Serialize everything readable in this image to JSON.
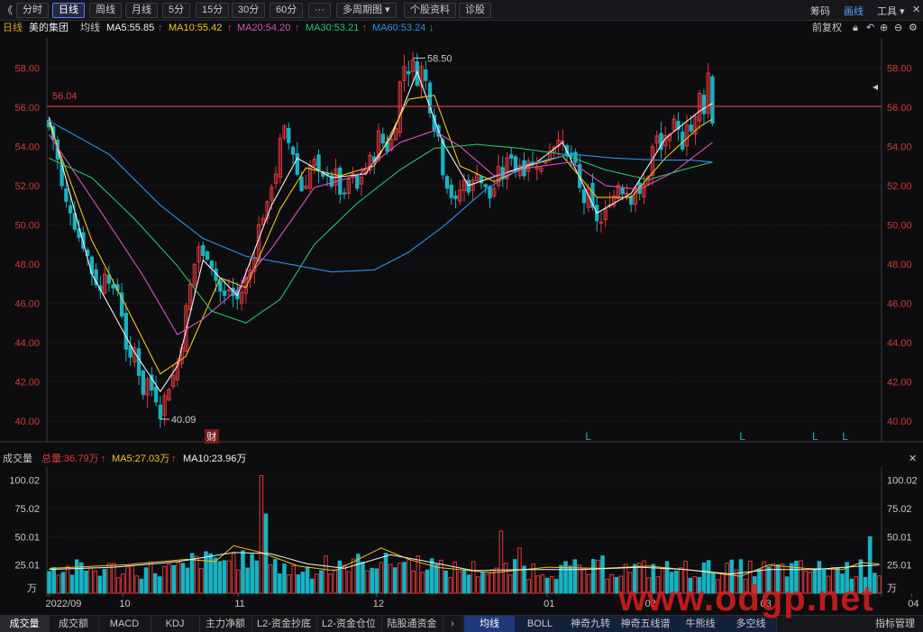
{
  "toolbar": {
    "back_glyph": "《",
    "tabs": [
      "分时",
      "日线",
      "周线",
      "月线",
      "5分",
      "15分",
      "30分",
      "60分",
      "···",
      "多周期图 ▾",
      "个股资料",
      "诊股"
    ],
    "active_tab": "日线",
    "right_items": [
      "筹码",
      "画线",
      "工具 ▾"
    ]
  },
  "info": {
    "period": "日线",
    "stock_name": "美的集团",
    "ma_label": "均线",
    "ma5": "MA5:55.85",
    "ma10": "MA10:55.42",
    "ma20": "MA20:54.20",
    "ma30": "MA30:53.21",
    "ma60": "MA60:53.24",
    "adjust": "前复权"
  },
  "colors": {
    "up": "#e0383b",
    "down": "#17b3c2",
    "ma5": "#f2f2f2",
    "ma10": "#f0c419",
    "ma20": "#e04fc2",
    "ma30": "#25c26a",
    "ma60": "#2f8ff0",
    "vol_ma5": "#f0c419",
    "vol_ma10": "#f2f2f2",
    "axis_text": "#d03a3a",
    "grid": "#252629"
  },
  "annotations": {
    "high_label": "58.50",
    "low_label": "40.09",
    "hline_label": "56.04",
    "hline_value": 56.04,
    "fin_badge": "财",
    "l_marker": "L"
  },
  "volume_info": {
    "title": "成交量",
    "total": "总量:36.79万",
    "ma5": "MA5:27.03万",
    "ma10": "MA10:23.96万",
    "unit": "万"
  },
  "bottom_tabs": [
    "成交量",
    "成交额",
    "MACD",
    "KDJ",
    "主力净额",
    "L2-资金抄底",
    "L2-资金仓位",
    "陆股通资金",
    "›",
    "均线",
    "BOLL",
    "神奇九转",
    "神奇五线谱",
    "牛熊线",
    "多空线",
    "指标管理"
  ],
  "watermark": "www.odgp.net",
  "chart_data": {
    "type": "candlestick",
    "price_axis": {
      "ylim": [
        39.4,
        59.3
      ],
      "ticks": [
        "58.00",
        "56.00",
        "54.00",
        "52.00",
        "50.00",
        "48.00",
        "46.00",
        "44.00",
        "42.00",
        "40.00"
      ]
    },
    "volume_axis": {
      "ylim": [
        0,
        110
      ],
      "ticks": [
        "100.02",
        "75.02",
        "50.01",
        "25.01"
      ],
      "unit": "万"
    },
    "x_labels": [
      "2022/09",
      "10",
      "11",
      "12",
      "01",
      "02",
      "03",
      "04"
    ],
    "x_label_bars": [
      0,
      16,
      41,
      71,
      108,
      130,
      155,
      187
    ],
    "l_marker_bars": [
      126,
      162,
      179,
      186
    ],
    "fin_badge_bar": 38,
    "close_path": [
      [
        0,
        55.0
      ],
      [
        1,
        54.4
      ],
      [
        2,
        53.3
      ],
      [
        3,
        51.9
      ],
      [
        4,
        51.1
      ],
      [
        5,
        50.8
      ],
      [
        6,
        50.0
      ],
      [
        7,
        49.4
      ],
      [
        8,
        49.0
      ],
      [
        9,
        48.4
      ],
      [
        10,
        47.6
      ],
      [
        11,
        47.1
      ],
      [
        12,
        46.6
      ],
      [
        13,
        47.7
      ],
      [
        14,
        47.3
      ],
      [
        15,
        46.5
      ],
      [
        16,
        46.7
      ],
      [
        17,
        45.5
      ],
      [
        18,
        43.8
      ],
      [
        19,
        43.0
      ],
      [
        20,
        43.7
      ],
      [
        21,
        42.5
      ],
      [
        22,
        41.5
      ],
      [
        23,
        42.1
      ],
      [
        24,
        41.6
      ],
      [
        25,
        41.2
      ],
      [
        26,
        40.4
      ],
      [
        27,
        41.2
      ],
      [
        28,
        41.8
      ],
      [
        29,
        42.3
      ],
      [
        30,
        43.0
      ],
      [
        31,
        44.0
      ],
      [
        32,
        45.7
      ],
      [
        33,
        46.9
      ],
      [
        34,
        48.0
      ],
      [
        35,
        48.9
      ],
      [
        36,
        48.3
      ],
      [
        37,
        48.5
      ],
      [
        38,
        48.0
      ],
      [
        39,
        47.2
      ],
      [
        40,
        46.6
      ],
      [
        41,
        46.3
      ],
      [
        42,
        46.7
      ],
      [
        43,
        46.4
      ],
      [
        44,
        46.2
      ],
      [
        45,
        46.6
      ],
      [
        46,
        47.2
      ],
      [
        47,
        47.7
      ],
      [
        48,
        48.6
      ],
      [
        49,
        49.9
      ],
      [
        50,
        50.5
      ],
      [
        51,
        50.9
      ],
      [
        52,
        52.1
      ],
      [
        53,
        52.7
      ],
      [
        54,
        54.2
      ],
      [
        55,
        54.8
      ],
      [
        56,
        54.2
      ],
      [
        57,
        53.7
      ],
      [
        58,
        52.6
      ],
      [
        59,
        51.8
      ],
      [
        60,
        52.2
      ],
      [
        61,
        53.0
      ],
      [
        62,
        53.2
      ],
      [
        63,
        52.5
      ],
      [
        64,
        52.3
      ],
      [
        65,
        52.8
      ],
      [
        66,
        52.1
      ],
      [
        67,
        52.6
      ],
      [
        68,
        51.7
      ],
      [
        69,
        51.3
      ],
      [
        70,
        52.3
      ],
      [
        71,
        52.4
      ],
      [
        72,
        51.8
      ],
      [
        73,
        52.5
      ],
      [
        74,
        52.9
      ],
      [
        75,
        53.3
      ],
      [
        76,
        53.5
      ],
      [
        77,
        54.6
      ],
      [
        78,
        54.2
      ],
      [
        79,
        53.9
      ],
      [
        80,
        54.3
      ],
      [
        81,
        55.2
      ],
      [
        82,
        57.2
      ],
      [
        83,
        58.1
      ],
      [
        84,
        57.9
      ],
      [
        85,
        58.2
      ],
      [
        86,
        57.4
      ],
      [
        87,
        58.0
      ],
      [
        88,
        57.3
      ],
      [
        89,
        56.0
      ],
      [
        90,
        55.1
      ],
      [
        91,
        54.5
      ],
      [
        92,
        52.8
      ],
      [
        93,
        52.1
      ],
      [
        94,
        51.5
      ],
      [
        95,
        51.1
      ],
      [
        96,
        51.8
      ],
      [
        97,
        52.2
      ],
      [
        98,
        51.9
      ],
      [
        99,
        52.1
      ],
      [
        100,
        52.8
      ],
      [
        101,
        52.2
      ],
      [
        102,
        51.8
      ],
      [
        103,
        51.4
      ],
      [
        104,
        51.9
      ],
      [
        105,
        52.7
      ],
      [
        106,
        52.5
      ],
      [
        107,
        53.2
      ],
      [
        108,
        53.6
      ],
      [
        109,
        52.8
      ],
      [
        110,
        53.1
      ],
      [
        111,
        52.8
      ],
      [
        112,
        53.4
      ],
      [
        113,
        53.0
      ],
      [
        114,
        53.2
      ],
      [
        115,
        52.8
      ],
      [
        116,
        53.4
      ],
      [
        117,
        53.9
      ],
      [
        118,
        54.1
      ],
      [
        119,
        54.6
      ],
      [
        120,
        54.0
      ],
      [
        121,
        53.4
      ],
      [
        122,
        53.5
      ],
      [
        123,
        52.9
      ],
      [
        124,
        51.8
      ],
      [
        125,
        51.2
      ],
      [
        126,
        51.6
      ],
      [
        127,
        50.7
      ],
      [
        128,
        50.3
      ],
      [
        129,
        50.1
      ],
      [
        130,
        50.6
      ],
      [
        131,
        51.3
      ],
      [
        132,
        51.5
      ],
      [
        133,
        52.1
      ],
      [
        134,
        51.8
      ],
      [
        135,
        51.7
      ],
      [
        136,
        51.3
      ],
      [
        137,
        52.0
      ],
      [
        138,
        51.4
      ],
      [
        139,
        52.0
      ],
      [
        140,
        52.6
      ],
      [
        141,
        53.9
      ],
      [
        142,
        54.4
      ],
      [
        143,
        53.8
      ],
      [
        144,
        54.6
      ],
      [
        145,
        54.3
      ],
      [
        146,
        55.1
      ],
      [
        147,
        54.7
      ],
      [
        148,
        54.1
      ],
      [
        149,
        55.3
      ],
      [
        150,
        54.8
      ],
      [
        151,
        55.4
      ],
      [
        152,
        56.6
      ],
      [
        153,
        55.9
      ],
      [
        154,
        57.7
      ],
      [
        155,
        55.3
      ]
    ],
    "ma_series": [
      {
        "key": "ma5",
        "values": [
          [
            0,
            55.5
          ],
          [
            10,
            47.5
          ],
          [
            20,
            43.5
          ],
          [
            26,
            41.5
          ],
          [
            30,
            42.8
          ],
          [
            36,
            48.2
          ],
          [
            44,
            46.4
          ],
          [
            52,
            51.0
          ],
          [
            58,
            53.4
          ],
          [
            66,
            52.4
          ],
          [
            74,
            52.6
          ],
          [
            80,
            54.5
          ],
          [
            86,
            57.8
          ],
          [
            92,
            54.2
          ],
          [
            98,
            52.0
          ],
          [
            106,
            52.6
          ],
          [
            114,
            53.2
          ],
          [
            120,
            54.2
          ],
          [
            128,
            50.6
          ],
          [
            136,
            51.6
          ],
          [
            144,
            54.4
          ],
          [
            152,
            55.8
          ],
          [
            155,
            56.2
          ]
        ]
      },
      {
        "key": "ma10",
        "values": [
          [
            0,
            55.2
          ],
          [
            10,
            49.2
          ],
          [
            20,
            45.0
          ],
          [
            26,
            42.4
          ],
          [
            32,
            43.3
          ],
          [
            40,
            47.3
          ],
          [
            46,
            46.8
          ],
          [
            54,
            50.8
          ],
          [
            60,
            52.9
          ],
          [
            68,
            52.5
          ],
          [
            76,
            53.0
          ],
          [
            84,
            56.4
          ],
          [
            90,
            56.6
          ],
          [
            96,
            53.0
          ],
          [
            104,
            52.2
          ],
          [
            112,
            53.0
          ],
          [
            120,
            53.5
          ],
          [
            128,
            51.4
          ],
          [
            136,
            51.4
          ],
          [
            144,
            53.4
          ],
          [
            152,
            55.0
          ],
          [
            155,
            55.4
          ]
        ]
      },
      {
        "key": "ma20",
        "values": [
          [
            0,
            54.6
          ],
          [
            12,
            50.7
          ],
          [
            22,
            47.4
          ],
          [
            30,
            44.4
          ],
          [
            36,
            45.2
          ],
          [
            44,
            46.7
          ],
          [
            52,
            48.8
          ],
          [
            62,
            51.9
          ],
          [
            72,
            52.5
          ],
          [
            82,
            54.2
          ],
          [
            90,
            54.8
          ],
          [
            96,
            54.0
          ],
          [
            104,
            52.5
          ],
          [
            112,
            52.9
          ],
          [
            122,
            53.2
          ],
          [
            130,
            52.0
          ],
          [
            138,
            51.8
          ],
          [
            146,
            52.7
          ],
          [
            155,
            54.2
          ]
        ]
      },
      {
        "key": "ma30",
        "values": [
          [
            0,
            53.4
          ],
          [
            10,
            52.4
          ],
          [
            20,
            50.3
          ],
          [
            30,
            47.9
          ],
          [
            38,
            45.6
          ],
          [
            46,
            45.0
          ],
          [
            54,
            46.2
          ],
          [
            62,
            49.0
          ],
          [
            72,
            51.1
          ],
          [
            82,
            52.8
          ],
          [
            90,
            53.9
          ],
          [
            100,
            54.1
          ],
          [
            110,
            53.9
          ],
          [
            120,
            53.6
          ],
          [
            130,
            52.8
          ],
          [
            140,
            52.3
          ],
          [
            148,
            52.8
          ],
          [
            155,
            53.2
          ]
        ]
      },
      {
        "key": "ma60",
        "values": [
          [
            0,
            55.3
          ],
          [
            14,
            53.6
          ],
          [
            26,
            51.0
          ],
          [
            36,
            49.3
          ],
          [
            46,
            48.4
          ],
          [
            56,
            48.0
          ],
          [
            66,
            47.6
          ],
          [
            76,
            47.7
          ],
          [
            84,
            48.6
          ],
          [
            92,
            49.9
          ],
          [
            102,
            51.8
          ],
          [
            112,
            53.1
          ],
          [
            122,
            53.6
          ],
          [
            132,
            53.4
          ],
          [
            142,
            53.3
          ],
          [
            150,
            53.3
          ],
          [
            155,
            53.2
          ]
        ]
      }
    ],
    "volume_ma": [
      {
        "key": "vol_ma5",
        "values": [
          [
            0,
            22
          ],
          [
            16,
            25
          ],
          [
            30,
            30
          ],
          [
            36,
            28
          ],
          [
            40,
            42
          ],
          [
            46,
            36
          ],
          [
            54,
            24
          ],
          [
            62,
            20
          ],
          [
            72,
            40
          ],
          [
            78,
            30
          ],
          [
            84,
            23
          ],
          [
            96,
            18
          ],
          [
            108,
            23
          ],
          [
            120,
            22
          ],
          [
            130,
            24
          ],
          [
            140,
            20
          ],
          [
            150,
            15
          ],
          [
            156,
            25
          ],
          [
            164,
            22
          ],
          [
            172,
            21
          ],
          [
            176,
            27
          ],
          [
            180,
            26
          ]
        ]
      },
      {
        "key": "vol_ma10",
        "values": [
          [
            0,
            21
          ],
          [
            14,
            23
          ],
          [
            28,
            28
          ],
          [
            40,
            36
          ],
          [
            48,
            35
          ],
          [
            56,
            26
          ],
          [
            64,
            22
          ],
          [
            74,
            34
          ],
          [
            82,
            28
          ],
          [
            92,
            20
          ],
          [
            104,
            21
          ],
          [
            116,
            21
          ],
          [
            128,
            23
          ],
          [
            138,
            21
          ],
          [
            148,
            17
          ],
          [
            156,
            21
          ],
          [
            166,
            21
          ],
          [
            176,
            24
          ],
          [
            180,
            25
          ]
        ]
      }
    ]
  }
}
